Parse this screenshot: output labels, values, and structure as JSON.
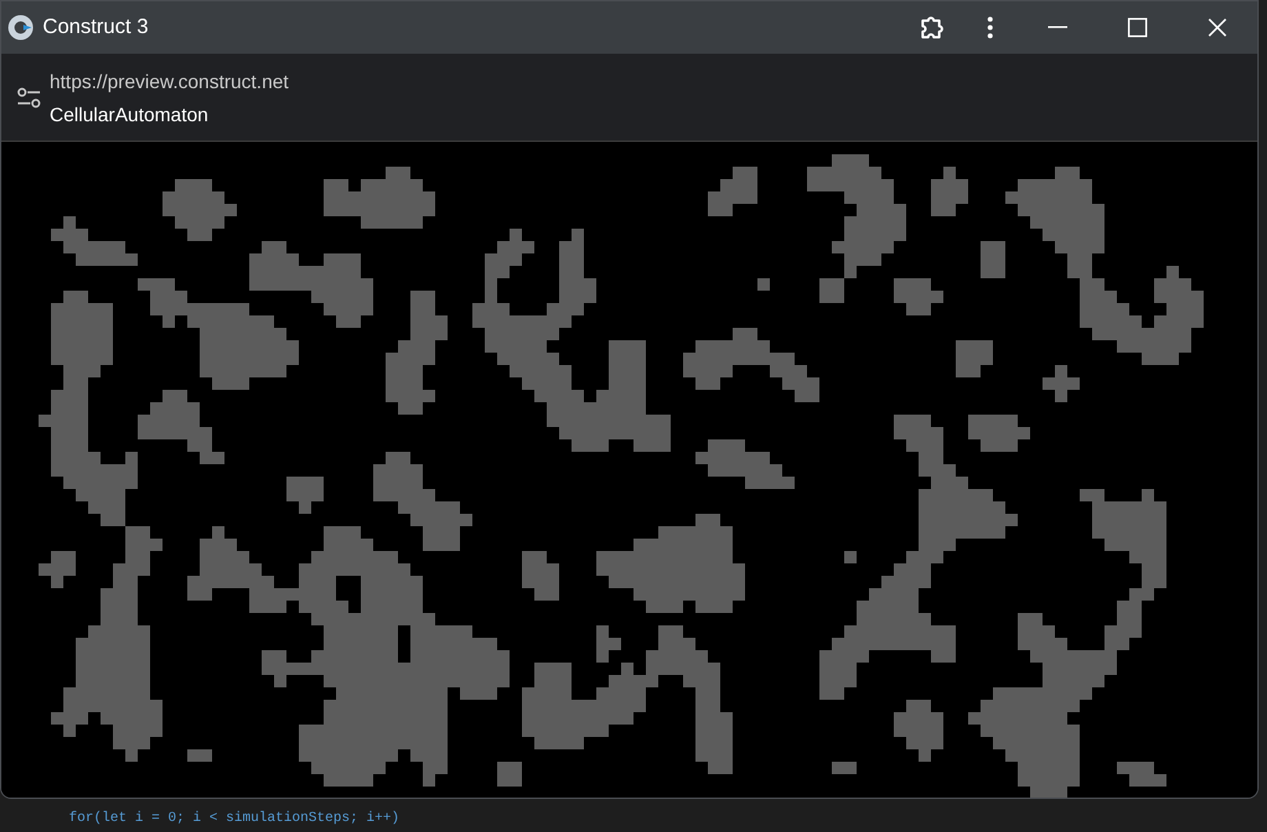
{
  "window": {
    "title": "Construct 3"
  },
  "address_bar": {
    "url": "https://preview.construct.net",
    "page_title": "CellularAutomaton"
  },
  "background_code": {
    "line": "for(let i = 0; i < simulationSteps; i++)"
  }
}
